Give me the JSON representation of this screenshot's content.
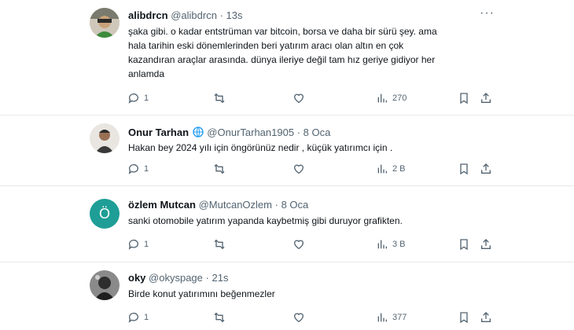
{
  "tweets": [
    {
      "name": "alibdrcn",
      "handle": "@alibdrcn",
      "time": "13s",
      "lines": [
        "şaka gibi. o kadar entstrüman var bitcoin, borsa ve daha bir sürü şey. ama",
        "hala tarihin eski dönemlerinden beri yatırım aracı olan altın en çok",
        "kazandıran araçlar arasında. dünya ileriye değil tam hız geriye gidiyor her",
        "anlamda"
      ],
      "replies": "1",
      "retweets": "",
      "likes": "",
      "views": "270"
    },
    {
      "name": "Onur Tarhan",
      "handle": "@OnurTarhan1905",
      "time": "8 Oca",
      "lines": [
        "Hakan bey 2024 yılı için öngörünüz nedir , küçük yatırımcı için ."
      ],
      "replies": "1",
      "retweets": "",
      "likes": "",
      "views": "2 B"
    },
    {
      "name": "özlem Mutcan",
      "handle": "@MutcanOzlem",
      "time": "8 Oca",
      "avatar_letter": "Ö",
      "lines": [
        "sanki otomobile yatırım yapanda kaybetmiş gibi duruyor grafikten."
      ],
      "replies": "1",
      "retweets": "",
      "likes": "",
      "views": "3 B"
    },
    {
      "name": "oky",
      "handle": "@okyspage",
      "time": "21s",
      "lines": [
        "Birde konut yatırımını beğenmezler"
      ],
      "replies": "1",
      "retweets": "",
      "likes": "",
      "views": "377"
    }
  ],
  "separator": "·",
  "more_glyph": "···",
  "colors": {
    "text": "#0f1419",
    "secondary": "#536471",
    "border": "#e7e9ea",
    "verified_globe": "#1d9bf0",
    "avatar_teal": "#1e9e96"
  }
}
